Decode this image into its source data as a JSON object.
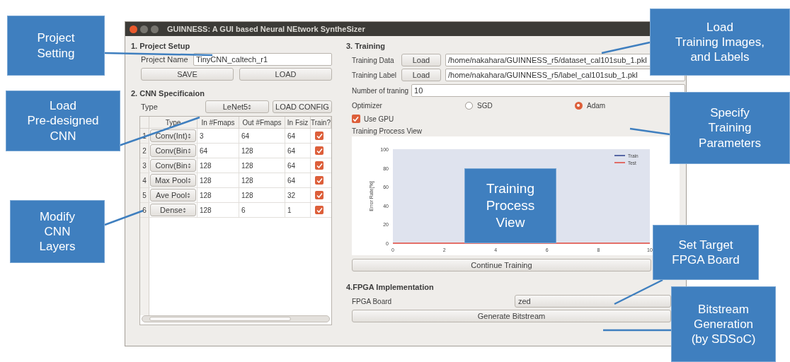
{
  "window": {
    "title": "GUINNESS: A GUI based Neural NEtwork SyntheSizer"
  },
  "project_setup": {
    "heading": "1. Project Setup",
    "name_label": "Project Name",
    "name_value": "TinyCNN_caltech_r1",
    "buttons": [
      "SAVE",
      "LOAD"
    ]
  },
  "cnn_spec": {
    "heading": "2. CNN Specificaion",
    "type_label": "Type",
    "type_value": "LeNet5",
    "load_config": "LOAD CONFIG",
    "table": {
      "columns": [
        "Type",
        "In #Fmaps",
        "Out #Fmaps",
        "In Fsiz",
        "Train?"
      ],
      "rows": [
        {
          "index": "1",
          "type": "Conv(Int)",
          "in_fmaps": "3",
          "out_fmaps": "64",
          "in_fsize": "64",
          "train": true
        },
        {
          "index": "2",
          "type": "Conv(Bin",
          "in_fmaps": "64",
          "out_fmaps": "128",
          "in_fsize": "64",
          "train": true
        },
        {
          "index": "3",
          "type": "Conv(Bin",
          "in_fmaps": "128",
          "out_fmaps": "128",
          "in_fsize": "64",
          "train": true
        },
        {
          "index": "4",
          "type": "Max Pool",
          "in_fmaps": "128",
          "out_fmaps": "128",
          "in_fsize": "64",
          "train": true
        },
        {
          "index": "5",
          "type": "Ave Pool",
          "in_fmaps": "128",
          "out_fmaps": "128",
          "in_fsize": "32",
          "train": true
        },
        {
          "index": "6",
          "type": "Dense",
          "in_fmaps": "128",
          "out_fmaps": "6",
          "in_fsize": "1",
          "train": true
        }
      ]
    }
  },
  "training": {
    "heading": "3. Training",
    "data_label": "Training Data",
    "data_button": "Load",
    "data_path": "/home/nakahara/GUINNESS_r5/dataset_cal101sub_1.pkl",
    "label_label": "Training Label",
    "label_button": "Load",
    "label_path": "/home/nakahara/GUINNESS_r5/label_cal101sub_1.pkl",
    "epochs_label": "Number of traning",
    "epochs": "10",
    "optimizer_label": "Optimizer",
    "optimizers": [
      {
        "label": "SGD",
        "selected": false
      },
      {
        "label": "Adam",
        "selected": true
      }
    ],
    "use_gpu": {
      "label": "Use GPU",
      "checked": true
    },
    "view_label": "Training Process View",
    "chart_data": {
      "type": "line",
      "ylabel": "Error Rate[%]",
      "x": [
        0,
        10
      ],
      "series": [
        {
          "name": "Train",
          "color": "#2b3f8c",
          "values": [
            null,
            null
          ]
        },
        {
          "name": "Test",
          "color": "#e0443a",
          "values": [
            0,
            0
          ]
        }
      ],
      "legend": "upper right",
      "xlim": [
        0,
        10
      ],
      "ylim": [
        0,
        100
      ],
      "xticks": [
        0,
        2,
        4,
        6,
        8,
        10
      ],
      "yticks": [
        0,
        20,
        40,
        60,
        80,
        100
      ]
    },
    "continue_button": "Continue Training"
  },
  "fpga": {
    "heading": "4.FPGA Implementation",
    "board_label": "FPGA Board",
    "board": "zed",
    "generate_button": "Generate Bitstream"
  },
  "callouts": [
    {
      "text": "Project\nSetting"
    },
    {
      "text": "Load\nPre-designed\nCNN"
    },
    {
      "text": "Modify\nCNN\nLayers"
    },
    {
      "text": "Load\nTraining Images,\nand Labels"
    },
    {
      "text": "Specify\nTraining\nParameters"
    },
    {
      "text": "Training\nProcess\nView"
    },
    {
      "text": "Set Target\nFPGA Board"
    },
    {
      "text": "Bitstream\nGeneration\n(by SDSoC)"
    }
  ]
}
